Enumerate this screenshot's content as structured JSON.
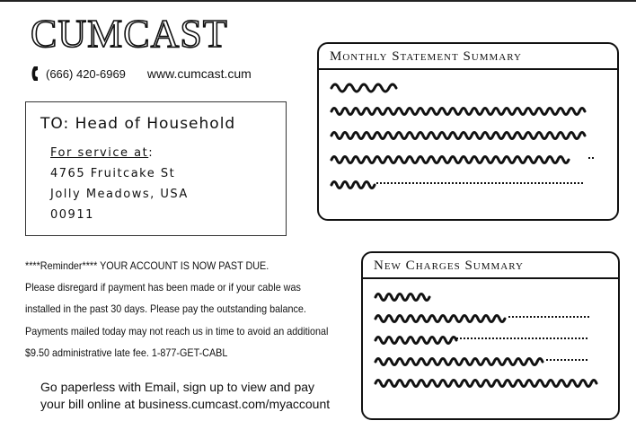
{
  "header": {
    "logo_text": "CUMCAST",
    "phone": "(666) 420-6969",
    "website": "www.cumcast.cum"
  },
  "recipient": {
    "to_line": "TO: Head of Household",
    "service_label": "For service at",
    "service_colon": ":",
    "street": "4765 Fruitcake St",
    "city": "Jolly Meadows, USA",
    "zip": "00911"
  },
  "reminder": {
    "lines": [
      "****Reminder**** YOUR ACCOUNT IS NOW PAST DUE.",
      "Please disregard if payment has been made or if your cable was",
      "installed in the past 30 days. Please pay the outstanding balance.",
      "Payments mailed today may not reach us in time to avoid an additional",
      "$9.50 administrative late fee. 1-877-GET-CABL"
    ]
  },
  "paperless": {
    "line1": "Go paperless with Email, sign up to view and pay",
    "line2": "your bill online at business.cumcast.com/myaccount"
  },
  "monthly_summary": {
    "title": "Monthly Statement Summary"
  },
  "new_charges": {
    "title": "New Charges Summary"
  },
  "icons": {
    "phone": "phone-icon"
  }
}
